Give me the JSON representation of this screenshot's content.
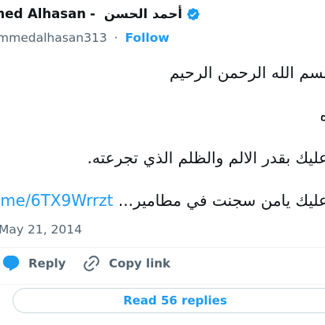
{
  "tweet": {
    "display_name_partial": "med Alhasan",
    "separator": "-",
    "arabic_name": "أحمد الحسن",
    "handle_partial": "mmedalhasan313",
    "dot": "·",
    "follow_label": "Follow",
    "lines": [
      "بسم الله الرحمن الرحيم",
      "ه",
      "عليك بقدر الالم والظلم الذي تجرعته.",
      "عليك يامن سجنت في مطامير..."
    ],
    "link_text": "me/6TX9Wrrzt",
    "date": "May 21, 2014"
  },
  "actions": {
    "reply_label": "Reply",
    "copy_link_label": "Copy link",
    "read_replies_label": "Read 56 replies"
  },
  "colors": {
    "accent": "#1d9bf0",
    "text": "#0f1419",
    "muted": "#536471"
  }
}
